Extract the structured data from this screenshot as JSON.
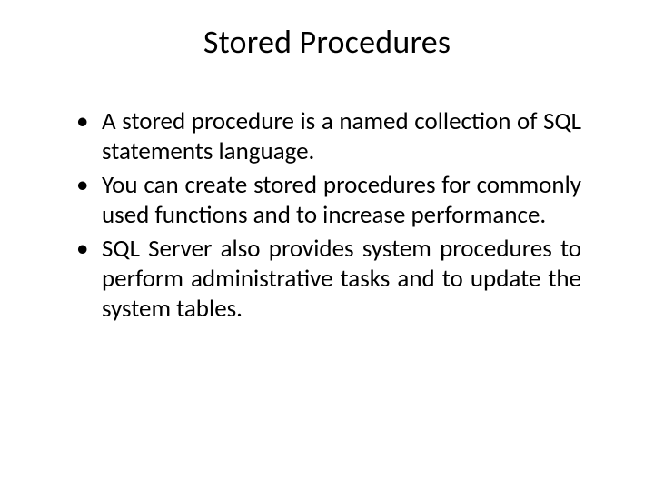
{
  "title": "Stored Procedures",
  "bullets": [
    "A stored procedure is a named collection of SQL statements language.",
    "You can create stored procedures for commonly used functions and to increase performance.",
    "SQL Server also provides system procedures to perform administrative tasks and to update the system tables."
  ]
}
